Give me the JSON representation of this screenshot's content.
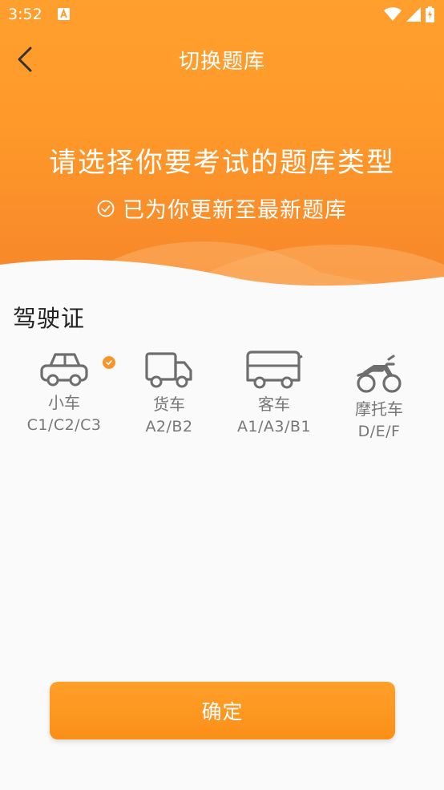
{
  "status_bar": {
    "time": "3:52"
  },
  "toolbar": {
    "title": "切换题库"
  },
  "hero": {
    "heading": "请选择你要考试的题库类型",
    "subtext": "已为你更新至最新题库"
  },
  "section": {
    "title": "驾驶证"
  },
  "types": [
    {
      "name": "小车",
      "code": "C1/C2/C3",
      "icon": "car-icon",
      "selected": true
    },
    {
      "name": "货车",
      "code": "A2/B2",
      "icon": "truck-icon",
      "selected": false
    },
    {
      "name": "客车",
      "code": "A1/A3/B1",
      "icon": "bus-icon",
      "selected": false
    },
    {
      "name": "摩托车",
      "code": "D/E/F",
      "icon": "motorcycle-icon",
      "selected": false
    }
  ],
  "confirm": {
    "label": "确定"
  },
  "colors": {
    "accent": "#ff9a2a",
    "icon_gray": "#6e6e6e"
  }
}
